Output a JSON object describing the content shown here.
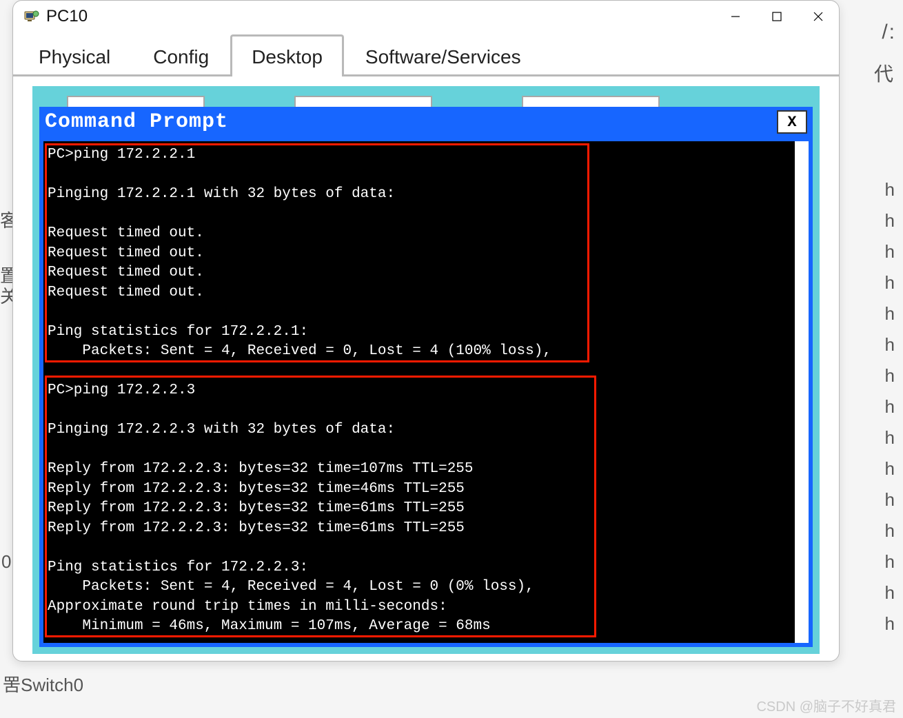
{
  "background": {
    "right1": "/:",
    "right2": "代",
    "left1": "客",
    "left2": "置",
    "left3": "关",
    "left4": "0",
    "bottom": "罟Switch0",
    "h_many": "h"
  },
  "window": {
    "title": "PC10",
    "tabs": [
      "Physical",
      "Config",
      "Desktop",
      "Software/Services"
    ],
    "active_tab": 2
  },
  "command_prompt": {
    "title": "Command Prompt",
    "close_label": "X"
  },
  "terminal": {
    "lines": [
      "PC>ping 172.2.2.1",
      "",
      "Pinging 172.2.2.1 with 32 bytes of data:",
      "",
      "Request timed out.",
      "Request timed out.",
      "Request timed out.",
      "Request timed out.",
      "",
      "Ping statistics for 172.2.2.1:",
      "    Packets: Sent = 4, Received = 0, Lost = 4 (100% loss),",
      "",
      "PC>ping 172.2.2.3",
      "",
      "Pinging 172.2.2.3 with 32 bytes of data:",
      "",
      "Reply from 172.2.2.3: bytes=32 time=107ms TTL=255",
      "Reply from 172.2.2.3: bytes=32 time=46ms TTL=255",
      "Reply from 172.2.2.3: bytes=32 time=61ms TTL=255",
      "Reply from 172.2.2.3: bytes=32 time=61ms TTL=255",
      "",
      "Ping statistics for 172.2.2.3:",
      "    Packets: Sent = 4, Received = 4, Lost = 0 (0% loss),",
      "Approximate round trip times in milli-seconds:",
      "    Minimum = 46ms, Maximum = 107ms, Average = 68ms"
    ]
  },
  "watermark": "CSDN @脑子不好真君"
}
